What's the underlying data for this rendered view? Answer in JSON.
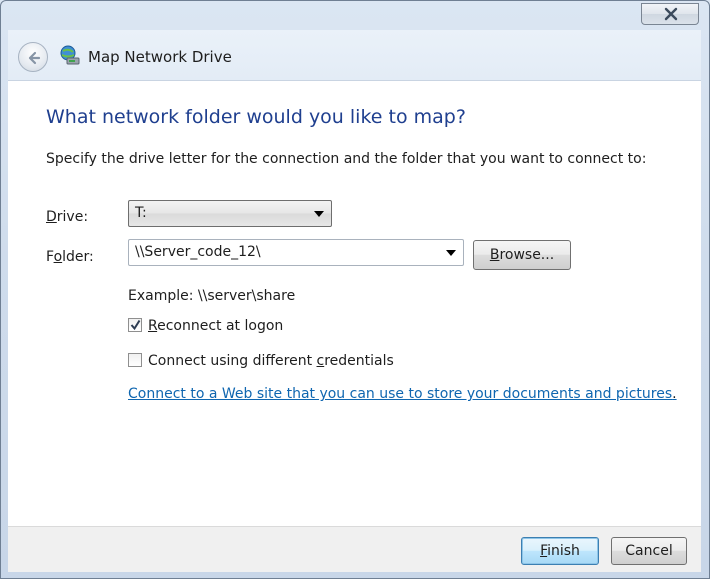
{
  "window": {
    "title": "Map Network Drive",
    "close_icon": "close-icon"
  },
  "header": {
    "back_icon": "back-arrow-icon",
    "app_icon": "network-drive-icon"
  },
  "content": {
    "heading": "What network folder would you like to map?",
    "instructions": "Specify the drive letter for the connection and the folder that you want to connect to:",
    "drive_label_prefix": "",
    "drive_label_accel": "D",
    "drive_label_rest": "rive:",
    "drive_value": "T:",
    "folder_label_prefix": "F",
    "folder_label_accel": "o",
    "folder_label_rest": "lder:",
    "folder_value": "\\\\Server_code_12\\",
    "browse_label_prefix": "",
    "browse_label_accel": "B",
    "browse_label_rest": "rowse...",
    "example_text": "Example: \\\\server\\share",
    "reconnect": {
      "checked": true,
      "label_prefix": "",
      "label_accel": "R",
      "label_rest": "econnect at logon"
    },
    "different_credentials": {
      "checked": false,
      "label_prefix": "Connect using different ",
      "label_accel": "c",
      "label_rest": "redentials"
    },
    "web_link": "Connect to a Web site that you can use to store your documents and pictures",
    "web_link_suffix": "."
  },
  "footer": {
    "finish_label_prefix": "",
    "finish_label_accel": "F",
    "finish_label_rest": "inish",
    "cancel_label": "Cancel"
  },
  "colors": {
    "heading": "#1f3f8f",
    "link": "#0f66b0",
    "default_button_border": "#3c7fb1"
  }
}
